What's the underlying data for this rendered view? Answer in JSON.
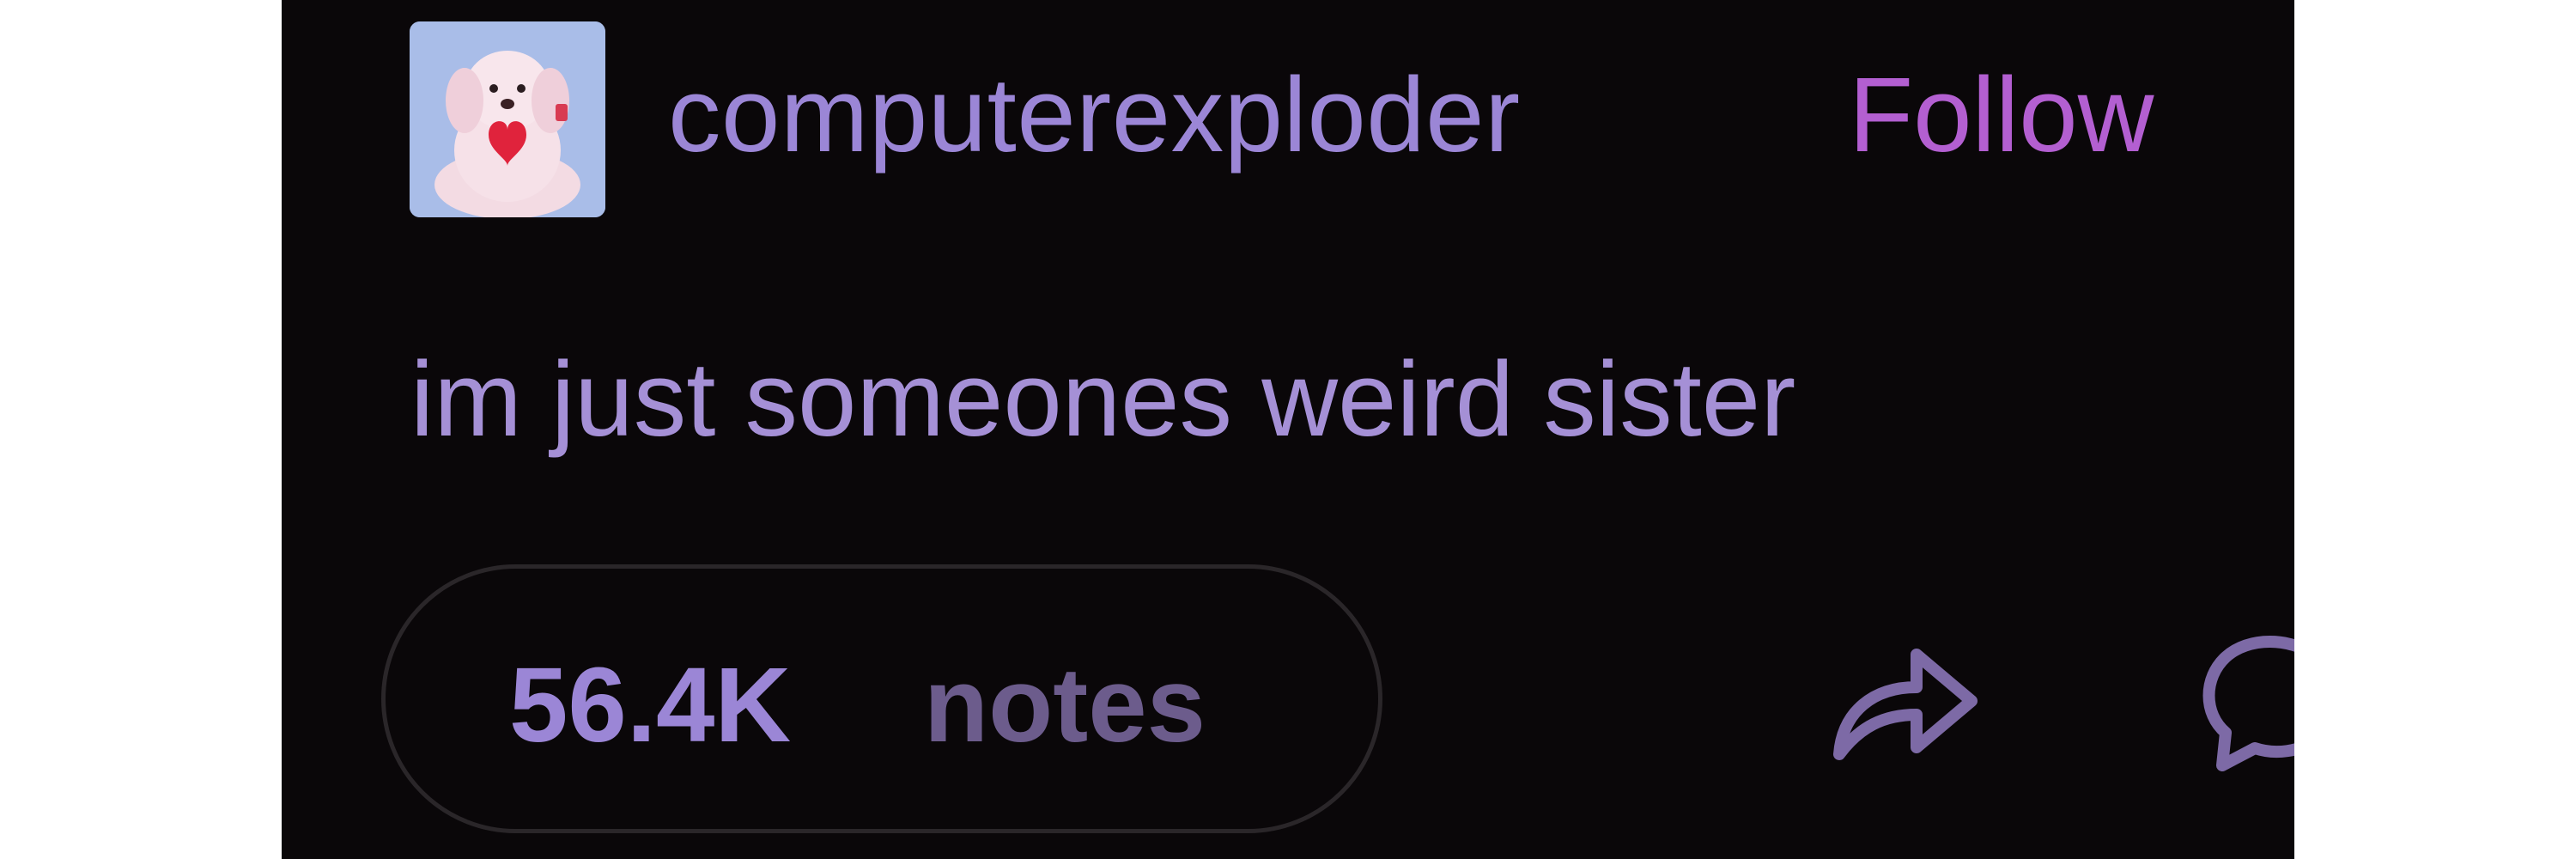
{
  "post": {
    "username": "computerexploder",
    "follow_label": "Follow",
    "text": "im just someones weird sister",
    "notes_count": "56.4K",
    "notes_label": "notes"
  },
  "icons": {
    "avatar": "plush-dog-avatar",
    "share": "share-arrow-icon",
    "reply": "reply-bubble-icon"
  },
  "colors": {
    "background": "#0a0709",
    "username": "#9b86d6",
    "follow": "#b35fd1",
    "text": "#a590d6",
    "notes_count": "#9b86d6",
    "notes_label": "#6c5c8c",
    "pill_border": "#2a2629"
  }
}
